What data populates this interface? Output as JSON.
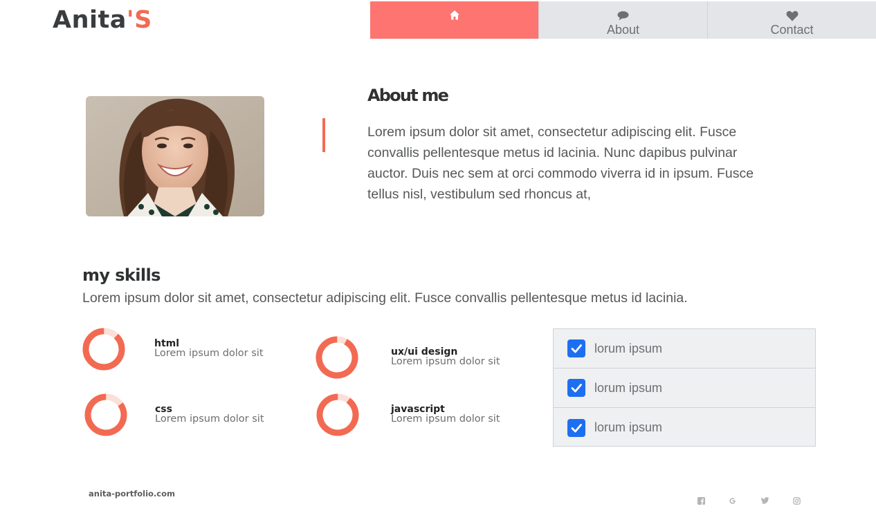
{
  "brand": {
    "logo_main": "Anita",
    "logo_apostrophe": "'",
    "logo_end": "S",
    "accent_color": "#f26a52",
    "active_nav_color": "#fd7470"
  },
  "nav": {
    "items": [
      {
        "label": "",
        "icon": "home-icon"
      },
      {
        "label": "About",
        "icon": "speech-bubble-icon"
      },
      {
        "label": "Contact",
        "icon": "heart-icon"
      }
    ]
  },
  "about": {
    "title": "About me",
    "text": "Lorem ipsum dolor sit amet, consectetur adipiscing elit. Fusce convallis pellentesque metus id lacinia. Nunc dapibus pulvinar auctor. Duis nec sem at orci commodo viverra id in ipsum. Fusce tellus nisl, vestibulum sed rhoncus at,",
    "photo_icon": "portrait-photo"
  },
  "skills": {
    "title": "my skills",
    "subtitle": "Lorem ipsum dolor sit amet, consectetur adipiscing elit. Fusce convallis pellentesque metus id lacinia.",
    "items": [
      {
        "name": "html",
        "desc": "Lorem ipsum dolor sit",
        "percent": 88
      },
      {
        "name": "ux/ui design",
        "desc": "Lorem ipsum dolor sit",
        "percent": 92
      },
      {
        "name": "css",
        "desc": "Lorem ipsum dolor sit",
        "percent": 85
      },
      {
        "name": "javascript",
        "desc": "Lorem ipsum dolor sit",
        "percent": 90
      }
    ]
  },
  "checklist": {
    "items": [
      {
        "label": "lorum ipsum",
        "checked": true
      },
      {
        "label": "lorum ipsum",
        "checked": true
      },
      {
        "label": "lorum ipsum",
        "checked": true
      }
    ]
  },
  "footer": {
    "site": "anita-portfolio.com",
    "social": [
      "facebook-icon",
      "google-icon",
      "twitter-icon",
      "instagram-icon"
    ]
  }
}
